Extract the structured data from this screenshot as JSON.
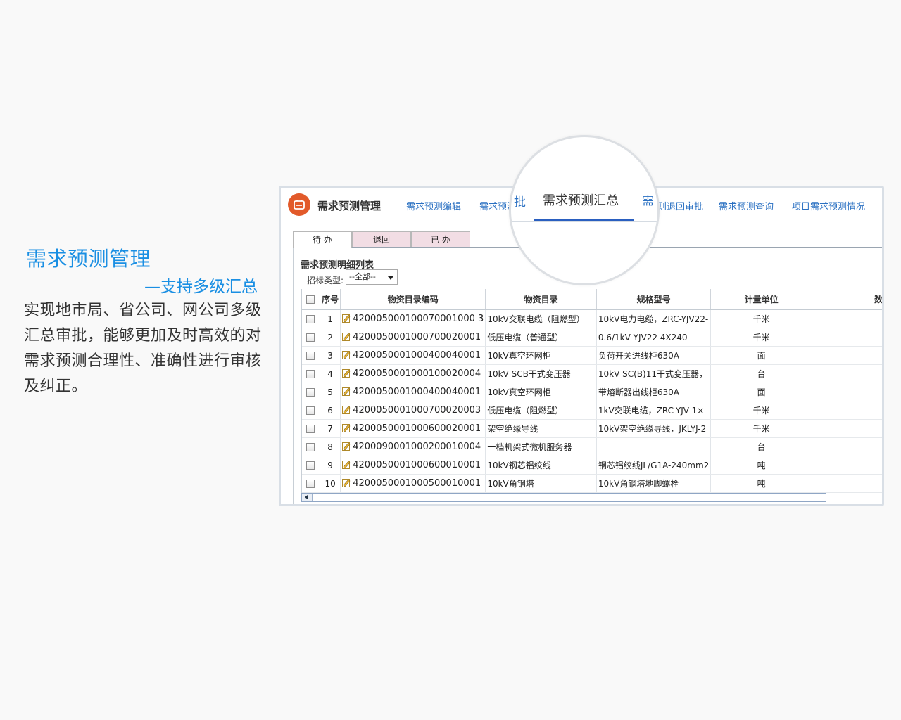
{
  "promo": {
    "title": "需求预测管理",
    "subtitle": "—支持多级汇总",
    "description": "实现地市局、省公司、网公司多级汇总审批，能够更加及时高效的对需求预测合理性、准确性进行审核及纠正。"
  },
  "app": {
    "title": "需求预测管理",
    "logo_icon": "cart-icon",
    "nav": [
      {
        "label": "需求预测编辑"
      },
      {
        "label": "需求预测"
      },
      {
        "label": "则退回审批"
      },
      {
        "label": "需求预测查询"
      },
      {
        "label": "项目需求预测情况"
      }
    ]
  },
  "magnifier": {
    "label": "需求预测汇总",
    "left_fragment": "批",
    "right_fragment": "需"
  },
  "tabs": [
    {
      "label": "待 办",
      "active": true
    },
    {
      "label": "退回",
      "active": false
    },
    {
      "label": "已 办",
      "active": false
    }
  ],
  "section_title": "需求预测明细列表",
  "filter": {
    "label": "招标类型:",
    "value": "--全部--"
  },
  "grid": {
    "columns": [
      "序号",
      "物资目录编码",
      "物资目录",
      "规格型号",
      "计量单位",
      "数"
    ],
    "rows": [
      [
        "1",
        "420005000100070001000 3",
        "10kV交联电缆（阻燃型）",
        "10kV电力电缆，ZRC-YJV22-",
        "千米"
      ],
      [
        "2",
        "4200050001000700020001",
        "低压电缆（普通型）",
        "0.6/1kV YJV22 4X240",
        "千米"
      ],
      [
        "3",
        "4200050001000400040001",
        "10kV真空环网柜",
        "负荷开关进线柜630A",
        "面"
      ],
      [
        "4",
        "4200050001000100020004",
        "10kV SCB干式变压器",
        "10kV SC(B)11干式变压器，",
        "台"
      ],
      [
        "5",
        "4200050001000400040001",
        "10kV真空环网柜",
        "带熔断器出线柜630A",
        "面"
      ],
      [
        "6",
        "4200050001000700020003",
        "低压电缆（阻燃型）",
        "1kV交联电缆，ZRC-YJV-1×",
        "千米"
      ],
      [
        "7",
        "4200050001000600020001",
        "架空绝缘导线",
        "10kV架空绝缘导线，JKLYJ-2",
        "千米"
      ],
      [
        "8",
        "4200090001000200010004",
        "一档机架式微机服务器",
        "",
        "台"
      ],
      [
        "9",
        "4200050001000600010001",
        "10kV钢芯铝绞线",
        "钢芯铝绞线JL/G1A-240mm2",
        "吨"
      ],
      [
        "10",
        "4200050001000500010001",
        "10kV角钢塔",
        "10kV角钢塔地脚螺栓",
        "吨"
      ]
    ]
  }
}
